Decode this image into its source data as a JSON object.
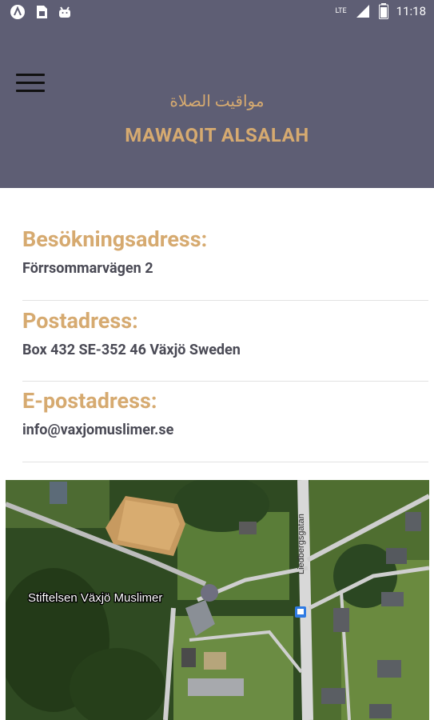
{
  "status_bar": {
    "time": "11:18",
    "left_icons": [
      "app-icon-a",
      "sim-card-icon",
      "android-icon"
    ],
    "right_icons": [
      "signal-lte-icon",
      "battery-icon"
    ],
    "network": "LTE"
  },
  "header": {
    "arabic_title": "مواقيت الصلاة",
    "title": "MAWAQIT ALSALAH"
  },
  "contact": {
    "visit_label": "Besökningsadress:",
    "visit_value": "Förrsommarvägen 2",
    "post_label": "Postadress:",
    "post_value": "Box 432 SE-352 46 Växjö Sweden",
    "email_label": "E-postadress:",
    "email_value": "info@vaxjomuslimer.se"
  },
  "map": {
    "place_label": "Stiftelsen Växjö Muslimer",
    "road_label": "Liedbergsgatan",
    "colors": {
      "dark_forest": "#2f4a22",
      "grass": "#6b8c43",
      "road": "#d8d8d8"
    }
  },
  "colors": {
    "header_bg": "#5e5e74",
    "accent_gold": "#d6aa70",
    "text_dark": "#4a4a55"
  }
}
